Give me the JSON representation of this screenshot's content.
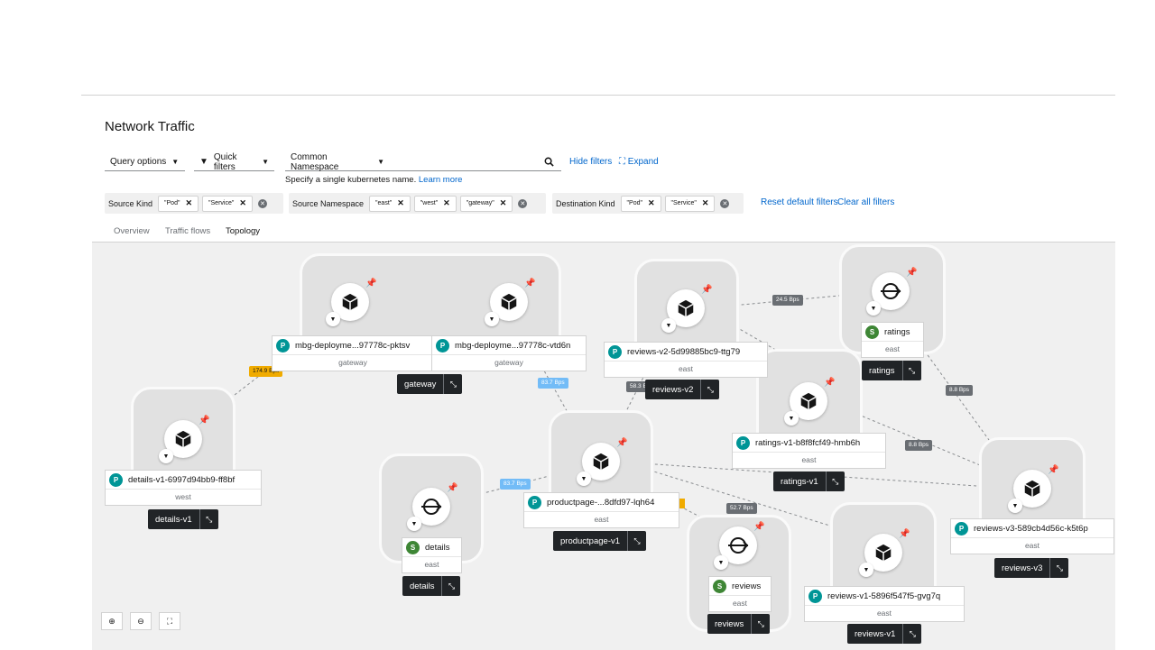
{
  "page": {
    "title": "Network Traffic"
  },
  "toolbar": {
    "query_options": "Query options",
    "quick_filters": "Quick filters",
    "namespace_select": "Common Namespace",
    "search_value": "",
    "hide_filters": "Hide filters",
    "expand": "Expand",
    "helper_text": "Specify a single kubernetes name.",
    "learn_more": "Learn more"
  },
  "filters": {
    "groups": [
      {
        "label": "Source Kind",
        "chips": [
          "\"Pod\"",
          "\"Service\""
        ]
      },
      {
        "label": "Source Namespace",
        "chips": [
          "\"east\"",
          "\"west\"",
          "\"gateway\""
        ]
      },
      {
        "label": "Destination Kind",
        "chips": [
          "\"Pod\"",
          "\"Service\""
        ]
      }
    ],
    "reset_default": "Reset default filters",
    "clear_all": "Clear all filters"
  },
  "tabs": [
    {
      "label": "Overview",
      "active": false
    },
    {
      "label": "Traffic flows",
      "active": false
    },
    {
      "label": "Topology",
      "active": true
    }
  ],
  "topology": {
    "nodes": [
      {
        "badge": "P",
        "name": "mbg-deployme...97778c-pktsv",
        "namespace": "gateway"
      },
      {
        "badge": "P",
        "name": "mbg-deployme...97778c-vtd6n",
        "namespace": "gateway"
      },
      {
        "badge": "P",
        "name": "reviews-v2-5d99885bc9-ttg79",
        "namespace": "east"
      },
      {
        "badge": "S",
        "name": "ratings",
        "namespace": "east"
      },
      {
        "badge": "P",
        "name": "details-v1-6997d94bb9-ff8bf",
        "namespace": "west"
      },
      {
        "badge": "P",
        "name": "ratings-v1-b8f8fcf49-hmb6h",
        "namespace": "east"
      },
      {
        "badge": "S",
        "name": "details",
        "namespace": "east"
      },
      {
        "badge": "P",
        "name": "productpage-...8dfd97-lqh64",
        "namespace": "east"
      },
      {
        "badge": "P",
        "name": "reviews-v3-589cb4d56c-k5t6p",
        "namespace": "east"
      },
      {
        "badge": "S",
        "name": "reviews",
        "namespace": "east"
      },
      {
        "badge": "P",
        "name": "reviews-v1-5896f547f5-gvg7q",
        "namespace": "east"
      }
    ],
    "groups": [
      "gateway",
      "reviews-v2",
      "ratings",
      "details-v1",
      "ratings-v1",
      "details",
      "productpage-v1",
      "reviews-v3",
      "reviews",
      "reviews-v1"
    ],
    "edge_labels": [
      "24.5 Bps",
      "174.9 Bps",
      "83.7 Bps",
      "58.3 Bps",
      "8.8 Bps",
      "8.8 Bps",
      "83.7 Bps",
      "52.7 Bps"
    ]
  },
  "icons": {
    "pod": "cube-icon",
    "service": "service-icon",
    "pin": "pin-icon",
    "filter": "filter-icon"
  }
}
